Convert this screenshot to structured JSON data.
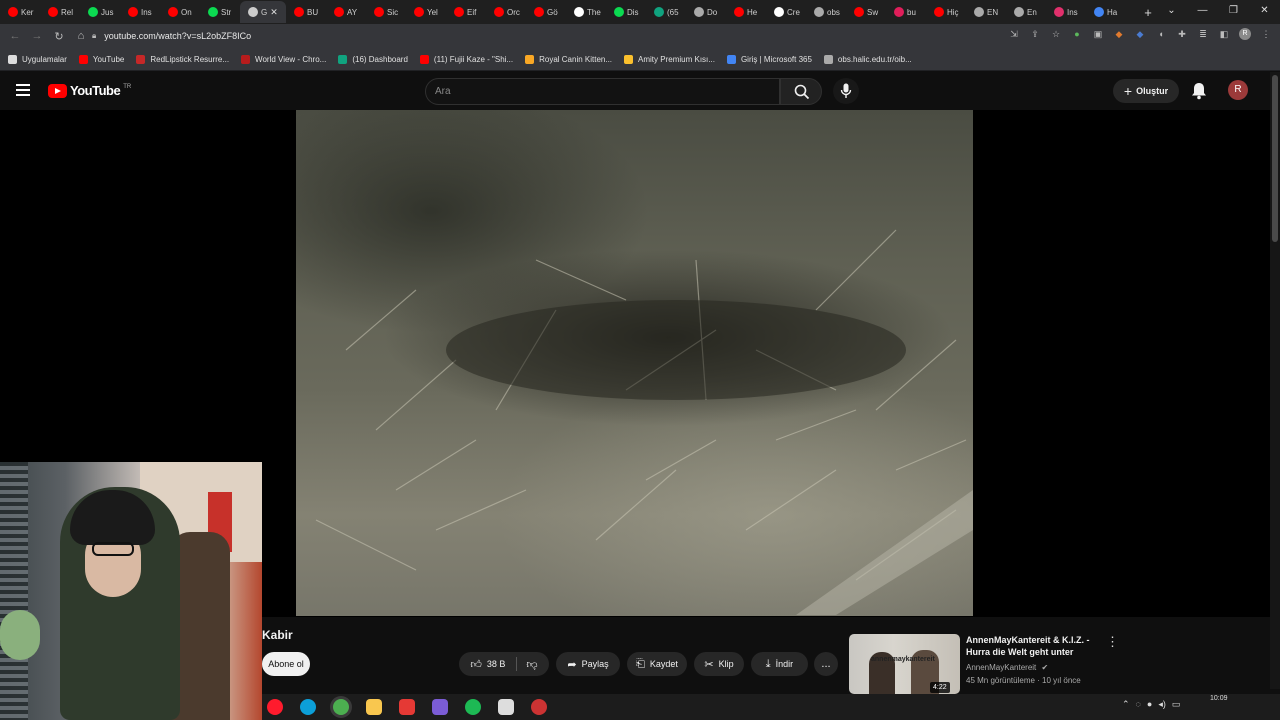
{
  "browser": {
    "tabs": [
      {
        "label": "Ker",
        "color": "#ff0000"
      },
      {
        "label": "Rel",
        "color": "#ff0000"
      },
      {
        "label": "Jus",
        "color": "#0bda51"
      },
      {
        "label": "Ins",
        "color": "#ff0000"
      },
      {
        "label": "On",
        "color": "#ff0000"
      },
      {
        "label": "Str",
        "color": "#0bda51"
      },
      {
        "label": "G",
        "color": "#cccccc",
        "active": true
      },
      {
        "label": "BU",
        "color": "#ff0000"
      },
      {
        "label": "AY",
        "color": "#ff0000"
      },
      {
        "label": "Sic",
        "color": "#ff0000"
      },
      {
        "label": "Yel",
        "color": "#ff0000"
      },
      {
        "label": "Eif",
        "color": "#ff0000"
      },
      {
        "label": "Orc",
        "color": "#ff0000"
      },
      {
        "label": "Gö",
        "color": "#ff0000"
      },
      {
        "label": "The",
        "color": "#ffffff"
      },
      {
        "label": "Dis",
        "color": "#0bda51"
      },
      {
        "label": "(65",
        "color": "#10a37f"
      },
      {
        "label": "Do",
        "color": "#aaaaaa"
      },
      {
        "label": "He",
        "color": "#ff0000"
      },
      {
        "label": "Cre",
        "color": "#ffffff"
      },
      {
        "label": "obs",
        "color": "#aaaaaa"
      },
      {
        "label": "Sw",
        "color": "#ff0000"
      },
      {
        "label": "bu",
        "color": "#e01e5a"
      },
      {
        "label": "Hiç",
        "color": "#ff0000"
      },
      {
        "label": "EN",
        "color": "#aaaaaa"
      },
      {
        "label": "En",
        "color": "#aaaaaa"
      },
      {
        "label": "Ins",
        "color": "#e1306c"
      },
      {
        "label": "Ha",
        "color": "#4285f4"
      }
    ],
    "new_tab_icon": "+",
    "url": "youtube.com/watch?v=sL2obZF8ICo",
    "bookmarks": [
      {
        "label": "Uygulamalar",
        "color": "#dddddd"
      },
      {
        "label": "YouTube",
        "color": "#ff0000"
      },
      {
        "label": "RedLipstick Resurre...",
        "color": "#c62828"
      },
      {
        "label": "World View - Chro...",
        "color": "#b71c1c"
      },
      {
        "label": "(16) Dashboard",
        "color": "#10a37f"
      },
      {
        "label": "(11) Fujii Kaze - \"Shi...",
        "color": "#ff0000"
      },
      {
        "label": "Royal Canin Kitten...",
        "color": "#f9a825"
      },
      {
        "label": "Amity Premium Kısı...",
        "color": "#fbc02d"
      },
      {
        "label": "Giriş | Microsoft 365",
        "color": "#4285f4"
      },
      {
        "label": "obs.halic.edu.tr/oib...",
        "color": "#aaaaaa"
      }
    ],
    "profile_initial": "R"
  },
  "youtube": {
    "logo_text": "YouTube",
    "logo_country": "TR",
    "search_placeholder": "Ara",
    "create_label": "Oluştur",
    "avatar_initial": "R",
    "video": {
      "title": "Kabir",
      "subscribe_label": "Abone ol",
      "like_count": "38 B",
      "share_label": "Paylaş",
      "save_label": "Kaydet",
      "clip_label": "Klip",
      "download_label": "İndir",
      "more_label": "..."
    },
    "recommendation": {
      "title": "AnnenMayKantereit & K.I.Z. - Hurra die Welt geht unter",
      "channel": "AnnenMayKantereit",
      "meta": "45 Mn görüntüleme · 10 yıl önce",
      "duration": "4:22",
      "thumb_text": "annenmaykantereit"
    }
  },
  "taskbar": {
    "clock_time": "10:09",
    "apps": [
      {
        "name": "opera",
        "color": "#ff1b2d"
      },
      {
        "name": "edge",
        "color": "#0c9fd8"
      },
      {
        "name": "chrome",
        "color": "#4caf50"
      },
      {
        "name": "files",
        "color": "#f9c74f"
      },
      {
        "name": "store",
        "color": "#e53935"
      },
      {
        "name": "discord-like",
        "color": "#7b5cd6"
      },
      {
        "name": "spotify",
        "color": "#1db954"
      },
      {
        "name": "steam-like",
        "color": "#dddddd"
      },
      {
        "name": "obs",
        "color": "#cc3333"
      }
    ]
  }
}
